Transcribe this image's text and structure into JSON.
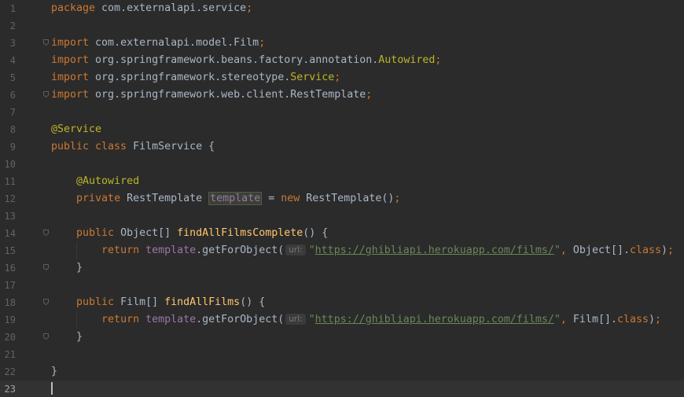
{
  "editor": {
    "language": "java",
    "current_line": 23,
    "colors": {
      "background": "#2b2b2b",
      "keyword": "#cc7832",
      "annotation": "#bbb529",
      "method": "#ffc66d",
      "field": "#9876aa",
      "string": "#6a8759",
      "text": "#a9b7c6",
      "line_number": "#606366"
    },
    "lines": [
      {
        "num": "1",
        "t": [
          {
            "c": "kw",
            "s": "package "
          },
          {
            "c": "",
            "s": "com.externalapi.service"
          },
          {
            "c": "semi",
            "s": ";"
          }
        ]
      },
      {
        "num": "2",
        "t": []
      },
      {
        "num": "3",
        "t": [
          {
            "c": "kw",
            "s": "import "
          },
          {
            "c": "",
            "s": "com.externalapi.model.Film"
          },
          {
            "c": "semi",
            "s": ";"
          }
        ]
      },
      {
        "num": "4",
        "t": [
          {
            "c": "kw",
            "s": "import "
          },
          {
            "c": "",
            "s": "org.springframework.beans.factory.annotation."
          },
          {
            "c": "ann",
            "s": "Autowired"
          },
          {
            "c": "semi",
            "s": ";"
          }
        ]
      },
      {
        "num": "5",
        "t": [
          {
            "c": "kw",
            "s": "import "
          },
          {
            "c": "",
            "s": "org.springframework.stereotype."
          },
          {
            "c": "ann",
            "s": "Service"
          },
          {
            "c": "semi",
            "s": ";"
          }
        ]
      },
      {
        "num": "6",
        "t": [
          {
            "c": "kw",
            "s": "import "
          },
          {
            "c": "",
            "s": "org.springframework.web.client.RestTemplate"
          },
          {
            "c": "semi",
            "s": ";"
          }
        ]
      },
      {
        "num": "7",
        "t": []
      },
      {
        "num": "8",
        "t": [
          {
            "c": "ann",
            "s": "@Service"
          }
        ]
      },
      {
        "num": "9",
        "t": [
          {
            "c": "kw",
            "s": "public class "
          },
          {
            "c": "",
            "s": "FilmService {"
          }
        ]
      },
      {
        "num": "10",
        "t": []
      },
      {
        "num": "11",
        "t": [
          {
            "c": "",
            "s": "    "
          },
          {
            "c": "ann",
            "s": "@Autowired"
          }
        ]
      },
      {
        "num": "12",
        "t": [
          {
            "c": "",
            "s": "    "
          },
          {
            "c": "kw",
            "s": "private "
          },
          {
            "c": "",
            "s": "RestTemplate "
          },
          {
            "c": "fld hl",
            "s": "template"
          },
          {
            "c": "",
            "s": " = "
          },
          {
            "c": "kw",
            "s": "new "
          },
          {
            "c": "",
            "s": "RestTemplate()"
          },
          {
            "c": "semi",
            "s": ";"
          }
        ]
      },
      {
        "num": "13",
        "t": []
      },
      {
        "num": "14",
        "t": [
          {
            "c": "",
            "s": "    "
          },
          {
            "c": "kw",
            "s": "public "
          },
          {
            "c": "",
            "s": "Object[] "
          },
          {
            "c": "fn",
            "s": "findAllFilmsComplete"
          },
          {
            "c": "",
            "s": "() {"
          }
        ]
      },
      {
        "num": "15",
        "t": [
          {
            "c": "",
            "s": "        "
          },
          {
            "c": "kw",
            "s": "return "
          },
          {
            "c": "fld",
            "s": "template"
          },
          {
            "c": "",
            "s": ".getForObject("
          },
          {
            "c": "hint",
            "s": "url:"
          },
          {
            "c": "str",
            "s": "\""
          },
          {
            "c": "url",
            "s": "https://ghibliapi.herokuapp.com/films/"
          },
          {
            "c": "str",
            "s": "\""
          },
          {
            "c": "semi",
            "s": ", "
          },
          {
            "c": "",
            "s": "Object[]."
          },
          {
            "c": "kw",
            "s": "class"
          },
          {
            "c": "",
            "s": ")"
          },
          {
            "c": "semi",
            "s": ";"
          }
        ]
      },
      {
        "num": "16",
        "t": [
          {
            "c": "",
            "s": "    }"
          }
        ]
      },
      {
        "num": "17",
        "t": []
      },
      {
        "num": "18",
        "t": [
          {
            "c": "",
            "s": "    "
          },
          {
            "c": "kw",
            "s": "public "
          },
          {
            "c": "",
            "s": "Film[] "
          },
          {
            "c": "fn",
            "s": "findAllFilms"
          },
          {
            "c": "",
            "s": "() {"
          }
        ]
      },
      {
        "num": "19",
        "t": [
          {
            "c": "",
            "s": "        "
          },
          {
            "c": "kw",
            "s": "return "
          },
          {
            "c": "fld",
            "s": "template"
          },
          {
            "c": "",
            "s": ".getForObject("
          },
          {
            "c": "hint",
            "s": "url:"
          },
          {
            "c": "str",
            "s": "\""
          },
          {
            "c": "url",
            "s": "https://ghibliapi.herokuapp.com/films/"
          },
          {
            "c": "str",
            "s": "\""
          },
          {
            "c": "semi",
            "s": ", "
          },
          {
            "c": "",
            "s": "Film[]."
          },
          {
            "c": "kw",
            "s": "class"
          },
          {
            "c": "",
            "s": ")"
          },
          {
            "c": "semi",
            "s": ";"
          }
        ]
      },
      {
        "num": "20",
        "t": [
          {
            "c": "",
            "s": "    }"
          }
        ]
      },
      {
        "num": "21",
        "t": []
      },
      {
        "num": "22",
        "t": [
          {
            "c": "",
            "s": "}"
          }
        ]
      },
      {
        "num": "23",
        "t": []
      }
    ],
    "fold_lines": [
      3,
      6,
      14,
      16,
      18,
      20
    ]
  }
}
